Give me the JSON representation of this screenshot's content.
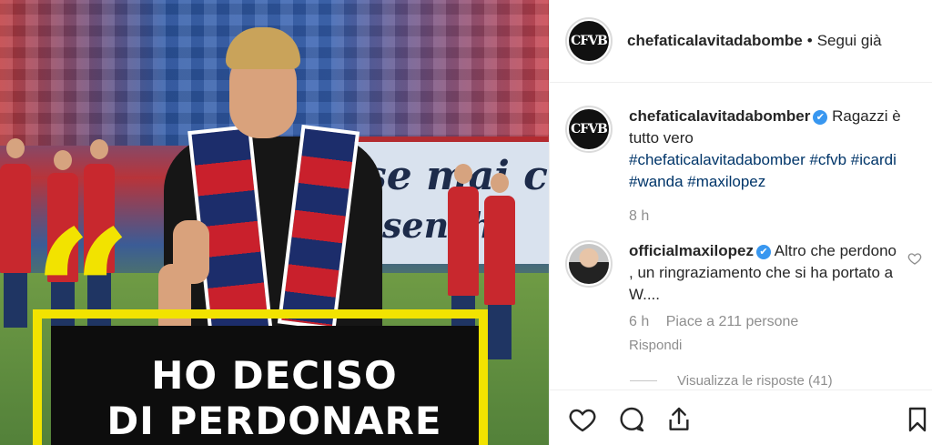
{
  "post_image": {
    "banner_line1": "se mai c",
    "banner_line2": "senzh",
    "quote_mark": "“",
    "headline_line1": "HO DECISO",
    "headline_line2": "DI PERDONARE"
  },
  "header": {
    "avatar_text": "CFVB",
    "username": "chefaticalavitadabombe",
    "separator": "•",
    "follow_label": "Segui già"
  },
  "caption": {
    "avatar_text": "CFVB",
    "username": "chefaticalavitadabomber",
    "verified_icon": "✔",
    "text": "Ragazzi è tutto vero",
    "hashtags": "#chefaticalavitadabomber #cfvb #icardi #wanda #maxilopez",
    "time": "8 h"
  },
  "comment": {
    "username": "officialmaxilopez",
    "verified_icon": "✔",
    "text": "Altro che perdono , un ringraziamento che si ha portato a W....",
    "time": "6 h",
    "likes": "Piace a 211 persone",
    "reply_label": "Rispondi",
    "view_replies": "Visualizza le risposte (41)"
  },
  "colors": {
    "accent": "#3897f0",
    "hashtag": "#003569",
    "meta": "#8e8e8e",
    "highlight_yellow": "#f2e300"
  },
  "icons": {
    "like": "heart-icon",
    "comment": "comment-icon",
    "share": "share-icon",
    "save": "bookmark-icon",
    "comment_like": "heart-outline-small-icon"
  }
}
